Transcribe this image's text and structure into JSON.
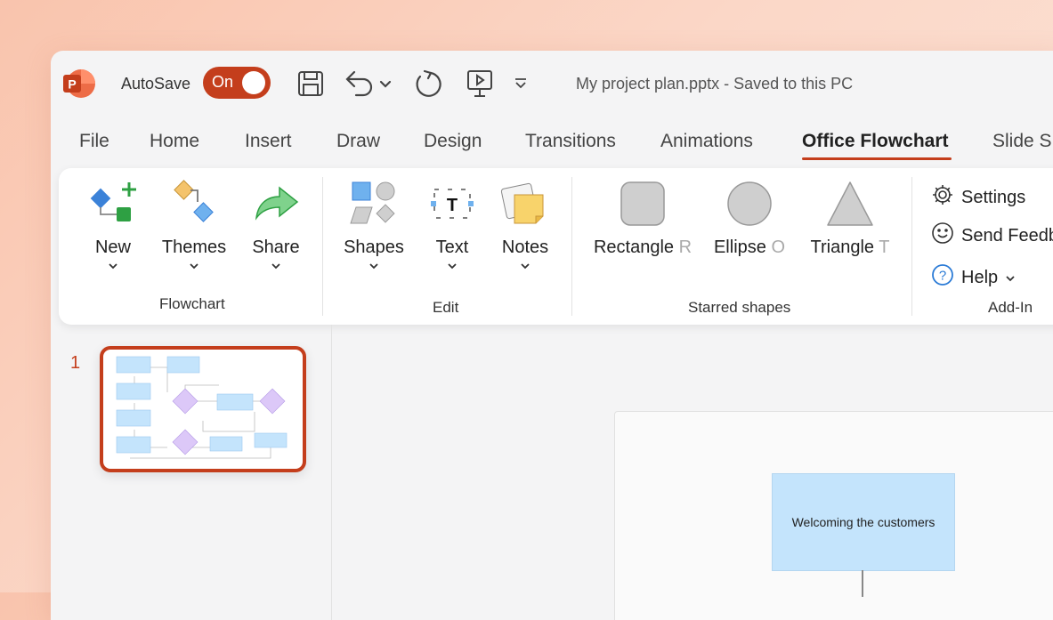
{
  "titlebar": {
    "autosave_label": "AutoSave",
    "autosave_toggle": "On",
    "document_title": "My project plan.pptx - Saved to this PC",
    "app_icon": "powerpoint-logo",
    "accent": "#c43e1c"
  },
  "tabs": [
    "File",
    "Home",
    "Insert",
    "Draw",
    "Design",
    "Transitions",
    "Animations",
    "Office Flowchart",
    "Slide S"
  ],
  "active_tab": "Office Flowchart",
  "ribbon": {
    "flowchart": {
      "label": "Flowchart",
      "buttons": [
        {
          "label": "New",
          "icon": "new-flowchart-icon"
        },
        {
          "label": "Themes",
          "icon": "themes-icon"
        },
        {
          "label": "Share",
          "icon": "share-arrow-icon"
        }
      ]
    },
    "edit": {
      "label": "Edit",
      "buttons": [
        {
          "label": "Shapes",
          "icon": "shapes-icon"
        },
        {
          "label": "Text",
          "icon": "text-box-icon"
        },
        {
          "label": "Notes",
          "icon": "sticky-note-icon"
        }
      ]
    },
    "starred": {
      "label": "Starred shapes",
      "buttons": [
        {
          "label": "Rectangle",
          "hint": "R"
        },
        {
          "label": "Ellipse",
          "hint": "O"
        },
        {
          "label": "Triangle",
          "hint": "T"
        }
      ]
    },
    "addin": {
      "label": "Add-In",
      "items": [
        {
          "label": "Settings",
          "icon": "gear-icon"
        },
        {
          "label": "Send Feedb",
          "icon": "smiley-icon"
        },
        {
          "label": "Help",
          "icon": "help-icon"
        }
      ]
    }
  },
  "slides": {
    "number": "1"
  },
  "canvas": {
    "first_node": "Welcoming the customers"
  }
}
